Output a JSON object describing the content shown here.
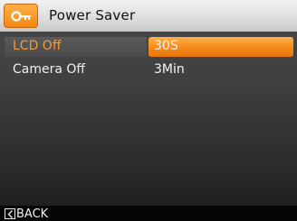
{
  "header": {
    "title": "Power Saver",
    "icon": "power-plug-icon"
  },
  "menu": [
    {
      "label": "LCD Off",
      "value": "30S",
      "selected": true
    },
    {
      "label": "Camera Off",
      "value": "3Min",
      "selected": false
    }
  ],
  "footer": {
    "back_label": "BACK",
    "back_icon": "chevron-left-icon"
  },
  "colors": {
    "accent": "#f58a18",
    "selected_label": "#f59a34"
  }
}
